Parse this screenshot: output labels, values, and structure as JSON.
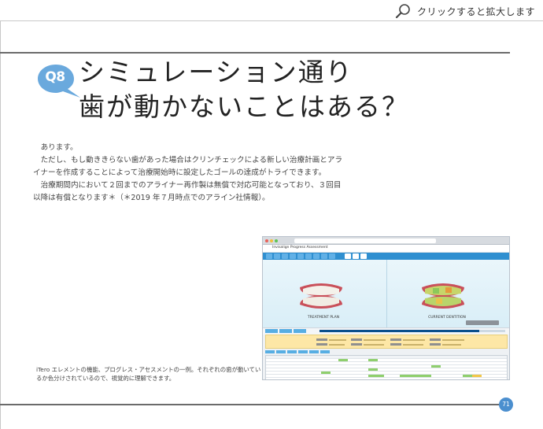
{
  "zoom_hint": {
    "label": "クリックすると拡大します",
    "icon": "magnifier-icon"
  },
  "question": {
    "badge": "Q8",
    "badge_color": "#6aa9dd",
    "title_line1": "シミュレーション通り",
    "title_line2": "歯が動かないことはある？"
  },
  "body": {
    "p1": "あります。",
    "p2": "ただし、もし動ききらない歯があった場合はクリンチェックによる新しい治療計画とアライナーを作成することによって治療開始時に設定したゴールの達成がトライできます。",
    "p3": "治療期間内において２回までのアライナー再作製は無償で対応可能となっており、３回目以降は有償となります＊（＊2019 年７月時点でのアライン社情報）。"
  },
  "screenshot": {
    "app_title": "Invisalign Progress Assessment",
    "left_view_label": "TREATMENT PLAN",
    "right_view_label": "CURRENT DENTITION",
    "toolbar_color": "#2f8fd0",
    "progress_fraction": 0.86
  },
  "caption": "iTero エレメントの機能、プログレス・アセスメントの一例。それぞれの歯が動いているか色分けされているので、視覚的に理解できます。",
  "page_number": "71",
  "page_number_color": "#4b8fcf"
}
